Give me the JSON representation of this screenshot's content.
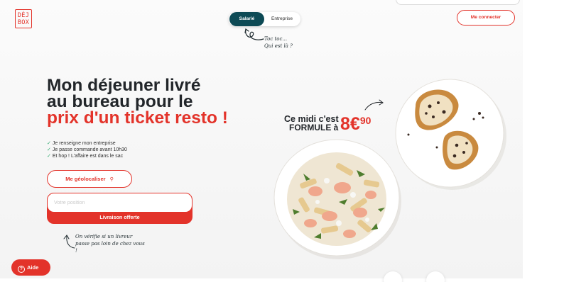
{
  "brand": {
    "logo_line1": "DÉJ",
    "logo_line2": "BOX",
    "accent": "#e3332a",
    "teal": "#0d4a55"
  },
  "header": {
    "toggle_options": [
      "Salarié",
      "Entreprise"
    ],
    "toggle_selected": "Salarié",
    "connect_label": "Me connecter"
  },
  "handwritten_top": {
    "line1": "Toc toc...",
    "line2": "Qui est là ?"
  },
  "headline": {
    "line1": "Mon déjeuner livré",
    "line2": "au bureau pour le",
    "line3": "prix d'un ticket resto !"
  },
  "bullets": [
    "Je renseigne mon entreprise",
    "Je passe commande avant 10h30",
    "Et hop ! L'affaire est dans le sac"
  ],
  "geo_button": {
    "label": "Me géolocaliser",
    "icon": "location-pin-icon"
  },
  "position_form": {
    "placeholder": "Votre position",
    "submit_label": "Livraison offerte"
  },
  "handwritten_bottom": {
    "line1": "On vérifie si un livreur",
    "line2": "passe pas loin de chez vous",
    "line3": "!"
  },
  "promo": {
    "line1": "Ce midi c'est",
    "line2": "FORMULE à",
    "price_main": "8€",
    "price_cents": "90"
  },
  "help_button": {
    "label": "Aide",
    "icon": "question-circle-icon"
  }
}
